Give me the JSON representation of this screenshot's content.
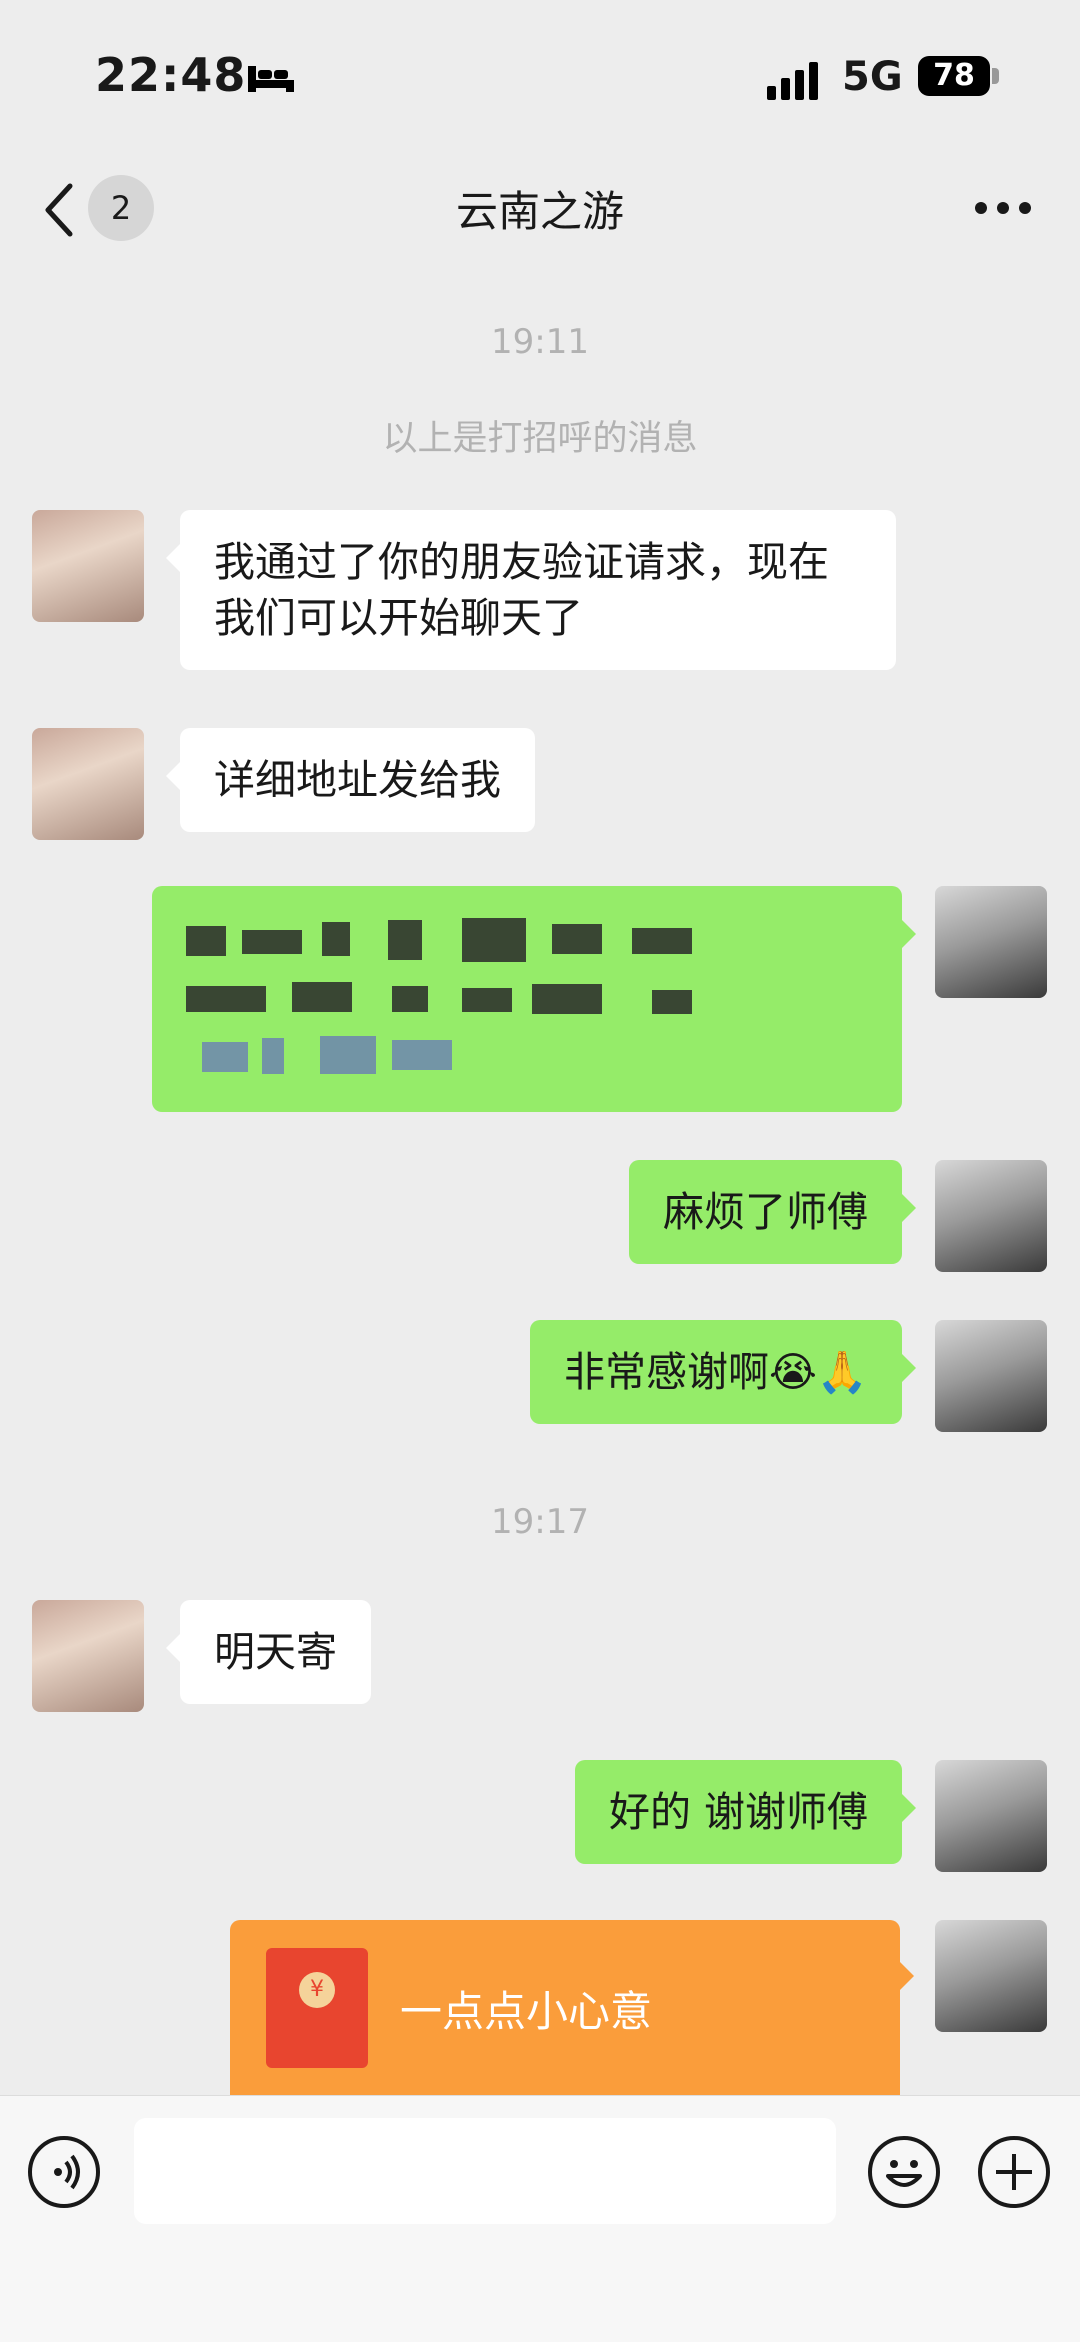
{
  "status": {
    "time": "22:48",
    "network": "5G",
    "battery": "78"
  },
  "nav": {
    "back_count": "2",
    "title": "云南之游"
  },
  "messages": {
    "time1": "19:11",
    "system": "以上是打招呼的消息",
    "m1": "我通过了你的朋友验证请求，现在我们可以开始聊天了",
    "m2": "详细地址发给我",
    "m4": "麻烦了师傅",
    "m5": "非常感谢啊😭🙏",
    "time2": "19:17",
    "m6": "明天寄",
    "m7": "好的 谢谢师傅",
    "redpacket": "一点点小心意"
  },
  "icons": {
    "status": [
      "bed-icon",
      "signal-icon",
      "battery-icon"
    ],
    "nav": [
      "back-icon",
      "more-icon"
    ],
    "input": [
      "voice-icon",
      "emoji-icon",
      "plus-icon"
    ]
  },
  "colors": {
    "outgoing": "#95ec69",
    "incoming": "#ffffff",
    "redpacket": "#fa9d3b",
    "background": "#ededed"
  }
}
